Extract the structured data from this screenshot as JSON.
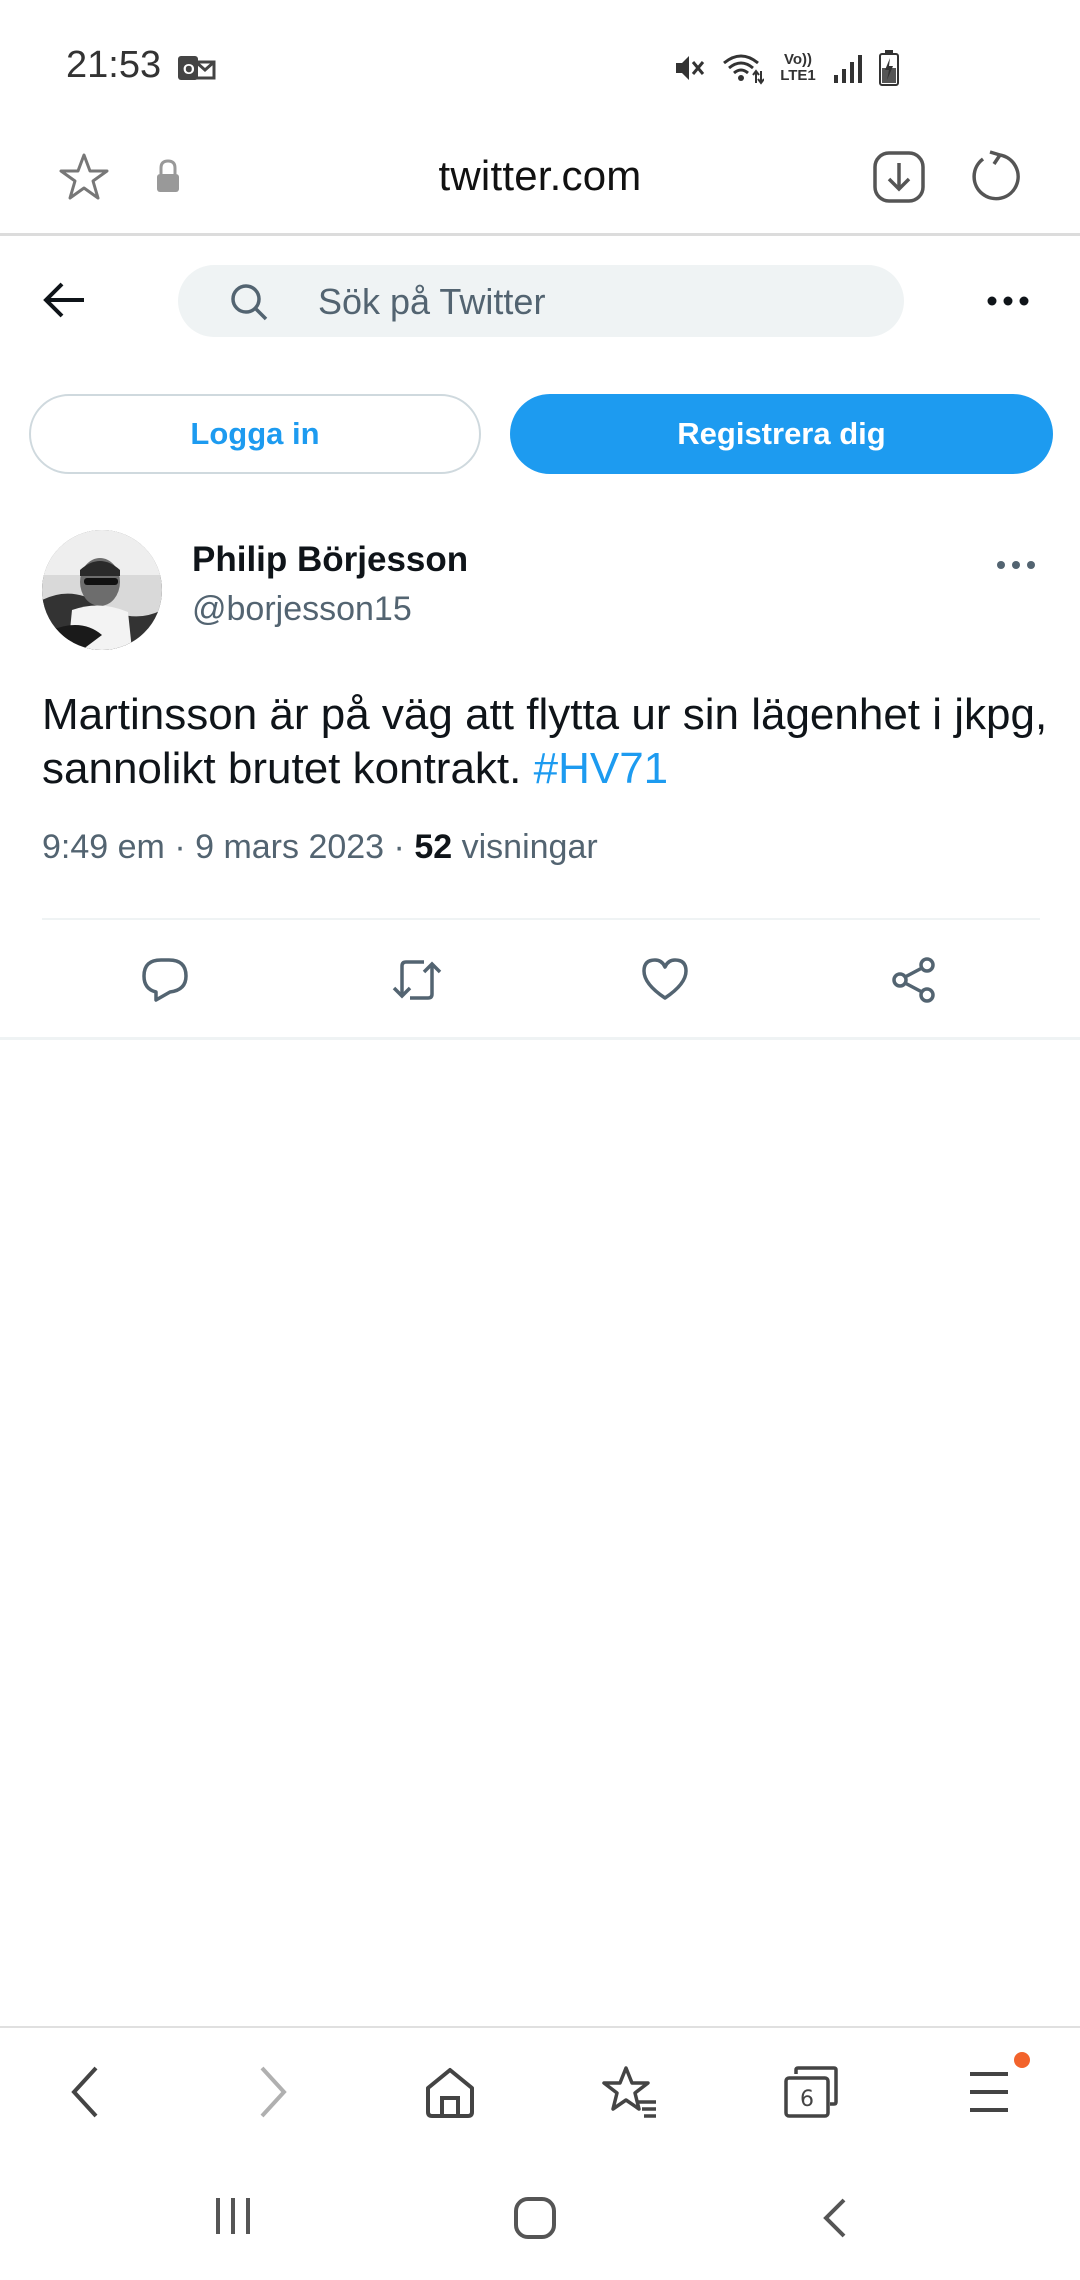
{
  "status_bar": {
    "time": "21:53",
    "network_label": "Vo)) LTE1",
    "icons": [
      "outlook-notification-icon",
      "mute-icon",
      "wifi-icon",
      "volte-icon",
      "signal-icon",
      "battery-charging-icon"
    ]
  },
  "browser": {
    "url": "twitter.com",
    "icons": [
      "bookmark-star-icon",
      "lock-icon",
      "download-icon",
      "reload-icon"
    ]
  },
  "header": {
    "search_placeholder": "Sök på Twitter",
    "icons": [
      "back-arrow-icon",
      "search-icon",
      "more-icon"
    ]
  },
  "auth": {
    "login_label": "Logga in",
    "signup_label": "Registrera dig"
  },
  "tweet": {
    "author_name": "Philip Börjesson",
    "author_handle": "@borjesson15",
    "text": "Martinsson är på väg att flytta ur sin lägenhet i jkpg, sannolikt brutet kontrakt.",
    "hashtag": "#HV71",
    "time": "9:49 em",
    "date": "9 mars 2023",
    "views_count": "52",
    "views_label": "visningar",
    "separator": "·",
    "actions": [
      "reply-icon",
      "retweet-icon",
      "like-icon",
      "share-icon"
    ]
  },
  "browser_nav": {
    "tabs_count": "6",
    "icons": [
      "back-icon",
      "forward-icon",
      "home-icon",
      "bookmarks-icon",
      "tabs-icon",
      "menu-icon"
    ]
  },
  "system_nav": {
    "icons": [
      "recents-icon",
      "home-button-icon",
      "system-back-icon"
    ]
  },
  "colors": {
    "accent": "#1d9bf0",
    "text_primary": "#0f1419",
    "text_secondary": "#536471",
    "search_bg": "#eff3f4",
    "notification_dot": "#f2632c"
  }
}
